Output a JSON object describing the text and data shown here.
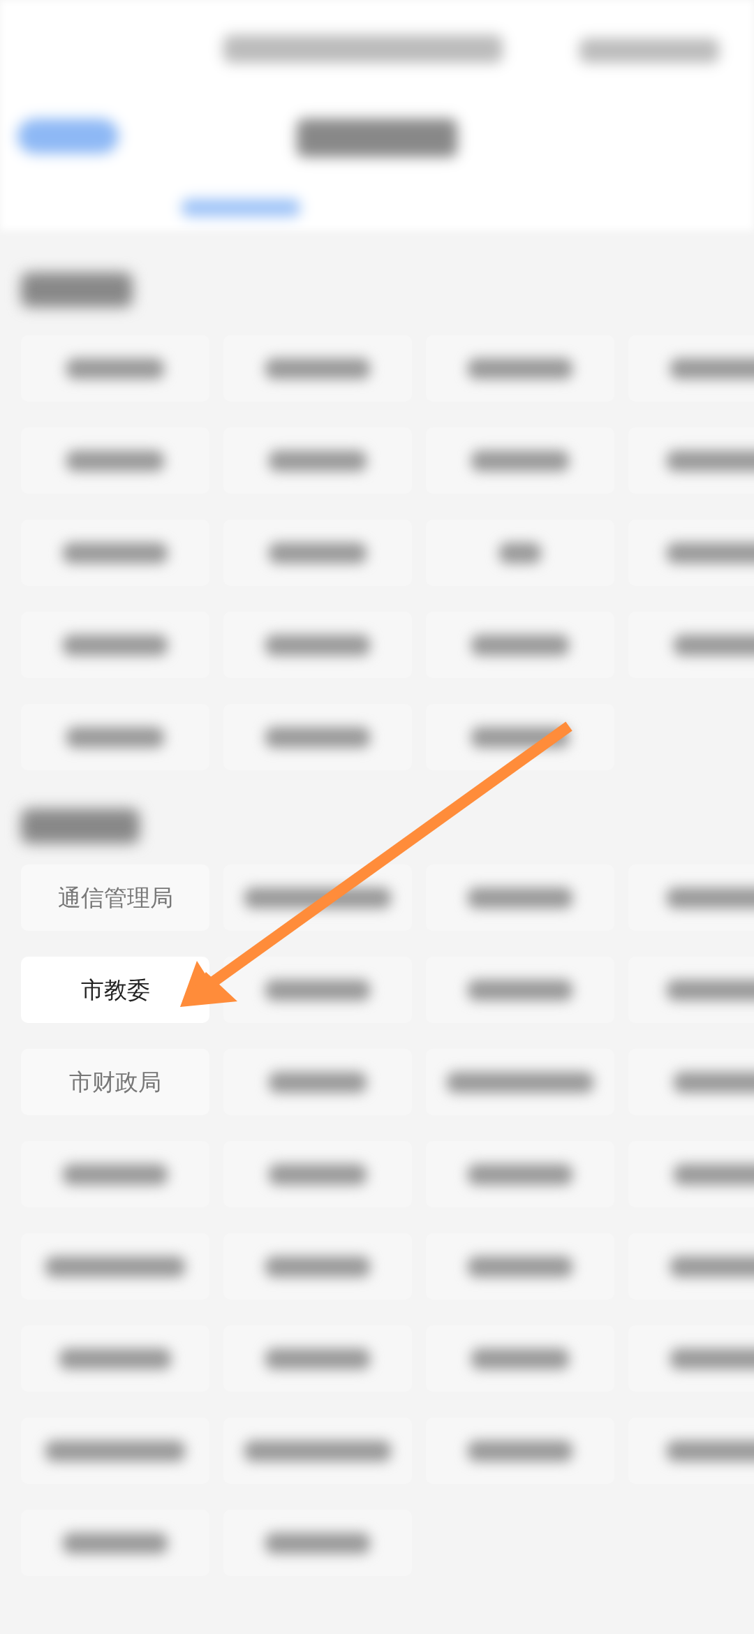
{
  "departments": {
    "tiles": [
      {
        "label": "通信管理局",
        "highlighted": false
      },
      {
        "label": "市教委",
        "highlighted": true
      },
      {
        "label": "市财政局",
        "highlighted": false
      }
    ]
  },
  "pointer": {
    "kind": "arrow"
  }
}
